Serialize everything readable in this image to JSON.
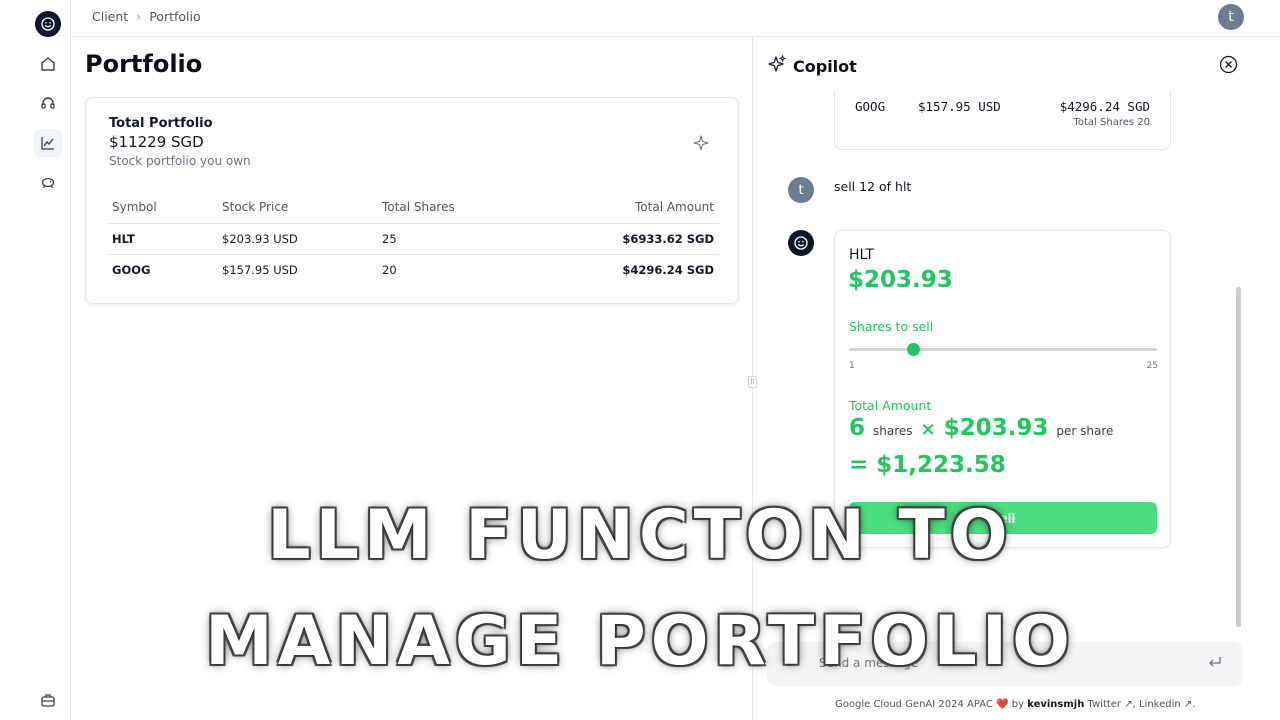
{
  "breadcrumb": {
    "items": [
      "Client",
      "Portfolio"
    ],
    "separator": "›"
  },
  "user": {
    "initial": "t"
  },
  "page": {
    "title": "Portfolio"
  },
  "portfolio_card": {
    "title": "Total Portfolio",
    "value": "$11229 SGD",
    "subtitle": "Stock portfolio you own",
    "columns": [
      "Symbol",
      "Stock Price",
      "Total Shares",
      "Total Amount"
    ],
    "rows": [
      {
        "symbol": "HLT",
        "price": "$203.93 USD",
        "shares": "25",
        "amount": "$6933.62 SGD"
      },
      {
        "symbol": "GOOG",
        "price": "$157.95 USD",
        "shares": "20",
        "amount": "$4296.24 SGD"
      }
    ]
  },
  "copilot": {
    "title": "Copilot",
    "previous": {
      "symbol": "GOOG",
      "price": "$157.95 USD",
      "amount": "$4296.24 SGD",
      "shares_note": "Total Shares 20"
    },
    "user_message": "sell 12 of hlt",
    "trade": {
      "symbol": "HLT",
      "price": "$203.93",
      "shares_label": "Shares to sell",
      "slider_min": "1",
      "slider_max": "25",
      "slider_value": 6,
      "total_label": "Total Amount",
      "shares": "6",
      "shares_word": "shares",
      "times": "×",
      "unit_price": "$203.93",
      "per_share": "per share",
      "result": "= $1,223.58",
      "button_label": "Sell"
    },
    "input_placeholder": "Send a message",
    "footer": {
      "prefix": "Google Cloud GenAI 2024 APAC",
      "heart": "❤️",
      "by": "by",
      "author": "kevinsmjh",
      "twitter": "Twitter ↗,",
      "linkedin": "Linkedin ↗."
    }
  },
  "overlay": {
    "line1": "LLM FUNCTON TO",
    "line2": "MANAGE PORTFOLIO"
  },
  "colors": {
    "accent_green": "#22c55e",
    "button_green": "#4ade80",
    "dark": "#0f172a"
  }
}
